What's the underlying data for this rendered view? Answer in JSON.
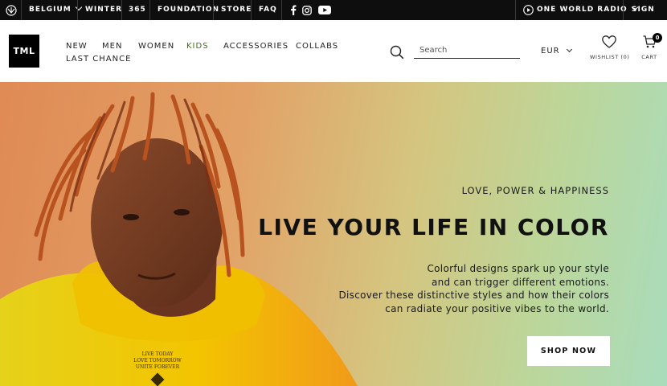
{
  "topbar": {
    "country": "BELGIUM",
    "links": [
      "WINTER",
      "365",
      "FOUNDATION",
      "STORE",
      "FAQ"
    ],
    "radio_label": "ONE WORLD RADIO",
    "sign_in": "SIGN IN",
    "icons": [
      "tomorrowland-logo-icon",
      "facebook-icon",
      "instagram-icon",
      "youtube-icon",
      "play-circle-icon"
    ]
  },
  "header": {
    "logo_text": "TML",
    "nav": {
      "new": "NEW",
      "men": "MEN",
      "women": "WOMEN",
      "kids": "KIDS",
      "accessories": "ACCESSORIES",
      "collabs": "COLLABS",
      "last_chance": "LAST CHANCE"
    },
    "search_placeholder": "Search",
    "currency": "EUR",
    "wishlist_label": "WISHLIST (0)",
    "cart_label": "CART",
    "cart_count": "0",
    "colors": {
      "kids_link": "#3f6e12"
    }
  },
  "hero": {
    "subtitle": "LOVE, POWER & HAPPINESS",
    "title": "LIVE YOUR LIFE IN COLOR",
    "description_lines": [
      "Colorful designs spark up your style",
      "and can trigger different emotions.",
      "Discover these distinctive styles and how their colors",
      "can radiate your positive vibes to the world."
    ],
    "cta": "SHOP NOW",
    "hoodie_print": [
      "LIVE TODAY",
      "LOVE TOMORROW",
      "UNITE FOREVER"
    ],
    "colors": {
      "bg_left": "#e08a55",
      "bg_right": "#a9dcbc",
      "hoodie": "#f2c300"
    }
  }
}
